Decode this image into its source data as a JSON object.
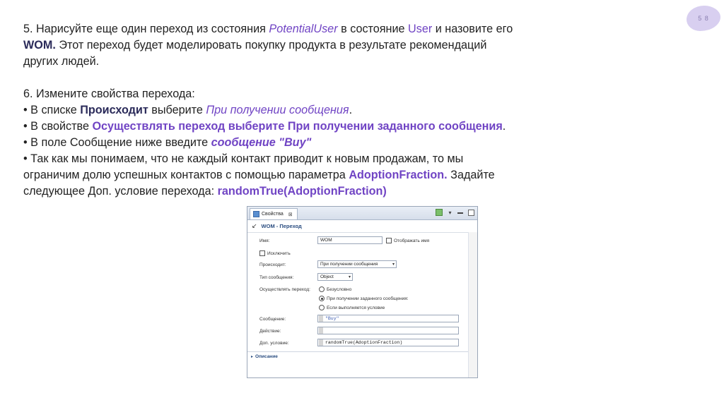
{
  "slide": {
    "number": "5 8"
  },
  "text": {
    "step5": {
      "a": "5. Нарисуйте еще один переход из состояния ",
      "state_from": "PotentialUser",
      "b": " в состояние ",
      "state_to": "User",
      "c": " и назовите его",
      "name": "WOM.",
      "d": " Этот переход будет моделировать покупку продукта в результате рекомендаций",
      "e": "других людей."
    },
    "step6": {
      "title": "6. Измените свойства перехода:",
      "b1_a": "• В списке ",
      "b1_field": "Происходит",
      "b1_b": " выберите ",
      "b1_value": "При получении сообщения",
      "b1_end": ".",
      "b2_a": "• В свойстве ",
      "b2_value": "Осуществлять переход выберите При получении заданного сообщения",
      "b2_end": ".",
      "b3_a": "• В поле Сообщение ниже введите ",
      "b3_value": "сообщение \"Buy\"",
      "b4_line1": "• Так как мы понимаем, что не каждый контакт приводит к новым продажам, то мы",
      "b4_line2_a": "ограничим долю успешных контактов с помощью параметра ",
      "b4_param": "AdoptionFraction.",
      "b4_line2_b": " Задайте",
      "b4_line3_a": "следующее Доп. условие перехода: ",
      "b4_code": "randomTrue(AdoptionFraction)"
    }
  },
  "window": {
    "tab_label": "Свойства",
    "tab_close": "⊠",
    "header_title": "WOM - Переход",
    "form": {
      "name_label": "Имя:",
      "name_value": "WOM",
      "show_name_label": "Отображать имя",
      "exclude_label": "Исключить",
      "occurs_label": "Происходит:",
      "occurs_value": "При получении сообщения",
      "msg_type_label": "Тип сообщения:",
      "msg_type_value": "Object",
      "trigger_label": "Осуществлять переход:",
      "radio_options": [
        "Безусловно",
        "При получении заданного сообщения:",
        "Если выполняется условие"
      ],
      "selected_radio": 1,
      "message_label": "Сообщение:",
      "message_value": "\"Buy\"",
      "action_label": "Действие:",
      "action_value": "",
      "guard_label": "Доп. условие:",
      "guard_value": "randomTrue(AdoptionFraction)"
    },
    "footer_label": "Описание"
  },
  "colors": {
    "accent": "#7044c4",
    "dark_accent": "#2b2b5a",
    "badge": "#d8cff0"
  }
}
